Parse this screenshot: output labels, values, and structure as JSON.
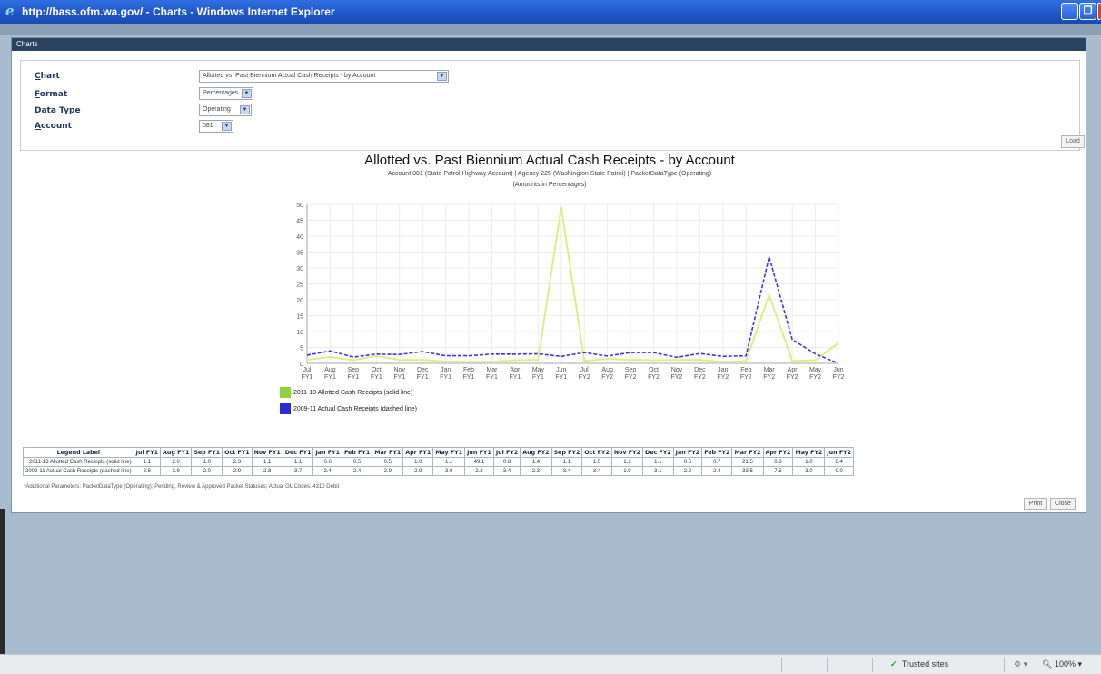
{
  "window": {
    "title": "http://bass.ofm.wa.gov/ - Charts - Windows Internet Explorer"
  },
  "dialog": {
    "header": "Charts"
  },
  "form": {
    "fields": [
      {
        "label": "Chart",
        "value": "Allotted vs. Past Biennium Actual Cash Receipts - by Account"
      },
      {
        "label": "Format",
        "value": "Percentages"
      },
      {
        "label": "Data Type",
        "value": "Operating"
      },
      {
        "label": "Account",
        "value": "081"
      }
    ],
    "load_label": "Load"
  },
  "chart_data": {
    "type": "line",
    "title": "Allotted vs. Past Biennium Actual Cash Receipts - by Account",
    "subtitle": "Account 081 (State Patrol Highway Account) | Agency 225 (Washington State Patrol) | PacketDataType (Operating)",
    "subtitle2": "(Amounts in Percentages)",
    "x_top": [
      "Jul",
      "Aug",
      "Sep",
      "Oct",
      "Nov",
      "Dec",
      "Jan",
      "Feb",
      "Mar",
      "Apr",
      "May",
      "Jun",
      "Jul",
      "Aug",
      "Sep",
      "Oct",
      "Nov",
      "Dec",
      "Jan",
      "Feb",
      "Mar",
      "Apr",
      "May",
      "Jun"
    ],
    "x_bottom": [
      "FY1",
      "FY1",
      "FY1",
      "FY1",
      "FY1",
      "FY1",
      "FY1",
      "FY1",
      "FY1",
      "FY1",
      "FY1",
      "FY1",
      "FY2",
      "FY2",
      "FY2",
      "FY2",
      "FY2",
      "FY2",
      "FY2",
      "FY2",
      "FY2",
      "FY2",
      "FY2",
      "FY2"
    ],
    "y_ticks": [
      0,
      5,
      10,
      15,
      20,
      25,
      30,
      35,
      40,
      45,
      50
    ],
    "ylim": [
      0,
      50
    ],
    "grid": true,
    "series": [
      {
        "name": "2011-13 Allotted Cash Receipts (solid line)",
        "color": "#dfee84",
        "style": "solid",
        "values": [
          1.1,
          2.0,
          1.0,
          2.3,
          1.1,
          1.1,
          0.6,
          0.5,
          0.5,
          1.0,
          1.1,
          49.1,
          0.8,
          1.4,
          1.1,
          1.0,
          1.1,
          1.1,
          0.5,
          0.7,
          21.5,
          0.8,
          1.0,
          6.4
        ]
      },
      {
        "name": "2009-11 Actual Cash Receipts (dashed line)",
        "color": "#3c36e6",
        "style": "dashed",
        "values": [
          2.6,
          3.9,
          2.0,
          2.9,
          2.8,
          3.7,
          2.4,
          2.4,
          2.9,
          2.9,
          3.0,
          2.2,
          3.4,
          2.3,
          3.4,
          3.4,
          1.9,
          3.1,
          2.2,
          2.4,
          33.5,
          7.5,
          3.0,
          0.0
        ]
      }
    ]
  },
  "legend": [
    {
      "label": "2011-13 Allotted Cash Receipts (solid line)",
      "color": "#8ed33b"
    },
    {
      "label": "2009-11 Actual Cash Receipts (dashed line)",
      "color": "#2b2bd8"
    }
  ],
  "table": {
    "headers": [
      "Legend Label",
      "Jul FY1",
      "Aug FY1",
      "Sep FY1",
      "Oct FY1",
      "Nov FY1",
      "Dec FY1",
      "Jan FY1",
      "Feb FY1",
      "Mar FY1",
      "Apr FY1",
      "May FY1",
      "Jun FY1",
      "Jul FY2",
      "Aug FY2",
      "Sep FY2",
      "Oct FY2",
      "Nov FY2",
      "Dec FY2",
      "Jan FY2",
      "Feb FY2",
      "Mar FY2",
      "Apr FY2",
      "May FY2",
      "Jun FY2"
    ],
    "rows": [
      [
        "2011-13 Allotted Cash Receipts (solid line)",
        "1.1",
        "2.0",
        "1.0",
        "2.3",
        "1.1",
        "1.1",
        "0.6",
        "0.5",
        "0.5",
        "1.0",
        "1.1",
        "49.1",
        "0.8",
        "1.4",
        "1.1",
        "1.0",
        "1.1",
        "1.1",
        "0.5",
        "0.7",
        "21.5",
        "0.8",
        "1.0",
        "6.4"
      ],
      [
        "2009-11 Actual Cash Receipts (dashed line)",
        "2.6",
        "3.9",
        "2.0",
        "2.9",
        "2.8",
        "3.7",
        "2.4",
        "2.4",
        "2.9",
        "2.9",
        "3.0",
        "2.2",
        "3.4",
        "2.3",
        "3.4",
        "3.4",
        "1.9",
        "3.1",
        "2.2",
        "2.4",
        "33.5",
        "7.5",
        "3.0",
        "0.0"
      ]
    ]
  },
  "footnote": "*Additional Parameters: PacketDataType (Operating); Pending, Review & Approved Packet Statuses; Actual GL Codes: 4310 Debit",
  "buttons": {
    "print": "Print",
    "close": "Close"
  },
  "statusbar": {
    "zone": "Trusted sites",
    "zoom": "100%"
  }
}
